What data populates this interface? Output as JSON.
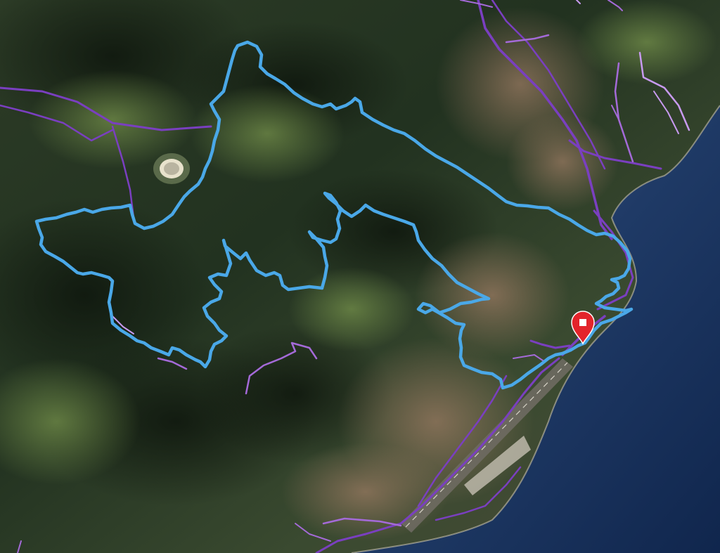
{
  "map": {
    "view": "satellite",
    "route": {
      "name": "",
      "color": "#4aa8e8"
    },
    "background_trails": {
      "colors": [
        "#7a3fc0",
        "#a46ad8",
        "#c89af0"
      ]
    },
    "marker": {
      "icon": "map-pin-icon",
      "color": "#e3242b",
      "inner_icon": "stop-square-icon"
    }
  }
}
